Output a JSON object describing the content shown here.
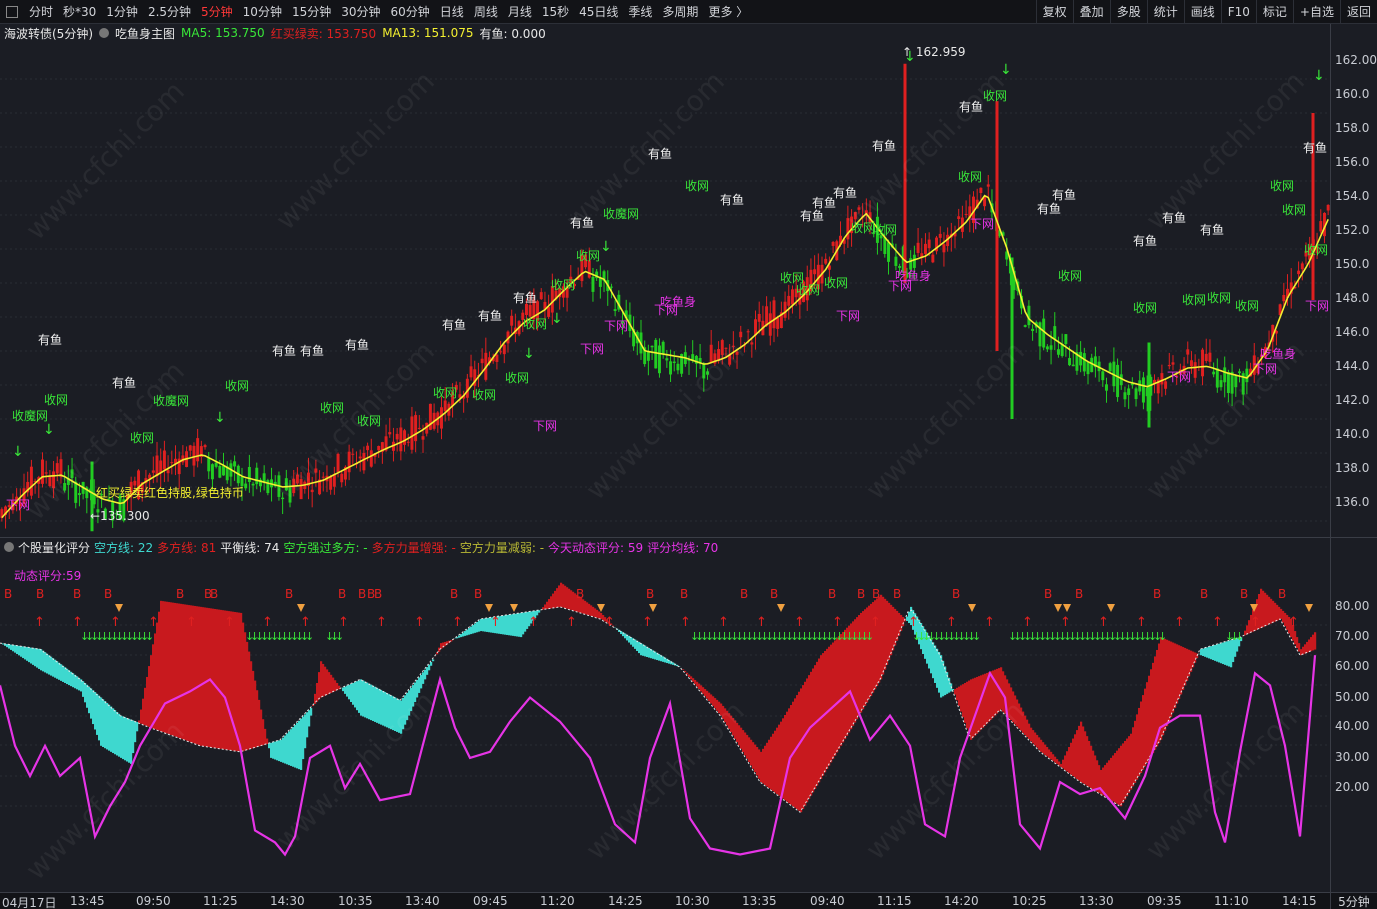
{
  "toolbar": {
    "tabs": [
      {
        "label": "分时",
        "active": false
      },
      {
        "label": "秒*30",
        "active": false
      },
      {
        "label": "1分钟",
        "active": false
      },
      {
        "label": "2.5分钟",
        "active": false
      },
      {
        "label": "5分钟",
        "active": true
      },
      {
        "label": "10分钟",
        "active": false
      },
      {
        "label": "15分钟",
        "active": false
      },
      {
        "label": "30分钟",
        "active": false
      },
      {
        "label": "60分钟",
        "active": false
      },
      {
        "label": "日线",
        "active": false
      },
      {
        "label": "周线",
        "active": false
      },
      {
        "label": "月线",
        "active": false
      },
      {
        "label": "15秒",
        "active": false
      },
      {
        "label": "45日线",
        "active": false
      },
      {
        "label": "季线",
        "active": false
      },
      {
        "label": "多周期",
        "active": false
      },
      {
        "label": "更多 〉",
        "active": false
      }
    ],
    "buttons": [
      "复权",
      "叠加",
      "多股",
      "统计",
      "画线",
      "F10",
      "标记",
      "+自选",
      "返回"
    ]
  },
  "main_header": {
    "security": "海波转债(5分钟)",
    "indicator": "吃鱼身主图",
    "ma5_label": "MA5: 153.750",
    "red_label": "红买绿卖: 153.750",
    "ma13_label": "MA13: 151.075",
    "fish_label": "有鱼: 0.000"
  },
  "main_axis": {
    "ticks": [
      "162.00",
      "160.0",
      "158.0",
      "156.0",
      "154.0",
      "152.0",
      "150.0",
      "148.0",
      "146.0",
      "144.0",
      "142.0",
      "140.0",
      "138.0",
      "136.0"
    ]
  },
  "main_annotations": {
    "high_label": "162.959",
    "low_label": "135.300",
    "legend_text": "红买绿卖红色持股,绿色持币",
    "signals": {
      "fish": "有鱼",
      "close_net": "收网",
      "drop_net": "下网",
      "close_net_magic": "收魔网",
      "eat_fish": "吃鱼身"
    }
  },
  "sub_header": {
    "title": "个股量化评分",
    "short_line": "空方线: 22",
    "long_line": "多方线: 81",
    "balance": "平衡线: 74",
    "short_over_long": "空方强过多方: -",
    "long_force": "多方力量增强: -",
    "short_force": "空方力量减弱: -",
    "today_score": "今天动态评分: 59",
    "score_avg": "评分均线: 70",
    "dynamic_label": "动态评分:59"
  },
  "sub_axis": {
    "ticks": [
      "80.00",
      "70.00",
      "60.00",
      "50.00",
      "40.00",
      "30.00",
      "20.00"
    ]
  },
  "sub_signals": {
    "buy": "B"
  },
  "time_axis": {
    "labels": [
      "04月17日",
      "13:45",
      "09:50",
      "11:25",
      "14:30",
      "10:35",
      "13:40",
      "09:45",
      "11:20",
      "14:25",
      "10:30",
      "13:35",
      "09:40",
      "11:15",
      "14:20",
      "10:25",
      "13:30",
      "09:35",
      "11:10",
      "14:15"
    ],
    "period": "5分钟"
  },
  "watermark": "www.cfchi.com",
  "colors": {
    "up": "#e02020",
    "down": "#22cc22",
    "ma5": "#f3f030",
    "long_fill": "#c8191e",
    "short_fill": "#3ed8cf",
    "score_line": "#e634e6",
    "signal_green": "#39e639",
    "signal_magenta": "#e634e6",
    "active_tab": "#ff3838"
  },
  "chart_data": [
    {
      "type": "candlestick",
      "title": "海波转债(5分钟)",
      "ylim": [
        135,
        163
      ],
      "high": 162.959,
      "low": 135.3,
      "series": [
        {
          "name": "MA5",
          "values": [
            136.2,
            137.5,
            138.6,
            138.7,
            138.0,
            137.3,
            137.0,
            138.2,
            138.9,
            139.6,
            139.9,
            139.3,
            138.6,
            138.3,
            138.0,
            138.1,
            138.4,
            139.0,
            139.6,
            140.2,
            140.7,
            141.4,
            142.3,
            143.4,
            144.9,
            146.5,
            147.7,
            148.4,
            149.6,
            150.7,
            150.2,
            148.1,
            146.0,
            145.8,
            145.6,
            145.2,
            145.6,
            146.4,
            147.5,
            148.3,
            149.4,
            150.8,
            152.8,
            154.1,
            152.6,
            151.2,
            151.6,
            152.5,
            153.6,
            155.3,
            152.1,
            148.0,
            147.0,
            146.2,
            145.4,
            144.8,
            144.2,
            143.9,
            144.4,
            145.0,
            145.1,
            144.7,
            144.4,
            146.1,
            149.2,
            151.1,
            153.75
          ]
        },
        {
          "name": "MA13",
          "values": [
            151.075
          ]
        }
      ]
    },
    {
      "type": "area",
      "title": "个股量化评分",
      "ylim": [
        0,
        90
      ],
      "series": [
        {
          "name": "空方线",
          "last": 22
        },
        {
          "name": "多方线",
          "last": 81
        },
        {
          "name": "平衡线",
          "last": 74
        },
        {
          "name": "今天动态评分",
          "last": 59
        },
        {
          "name": "评分均线",
          "last": 70
        }
      ]
    }
  ]
}
